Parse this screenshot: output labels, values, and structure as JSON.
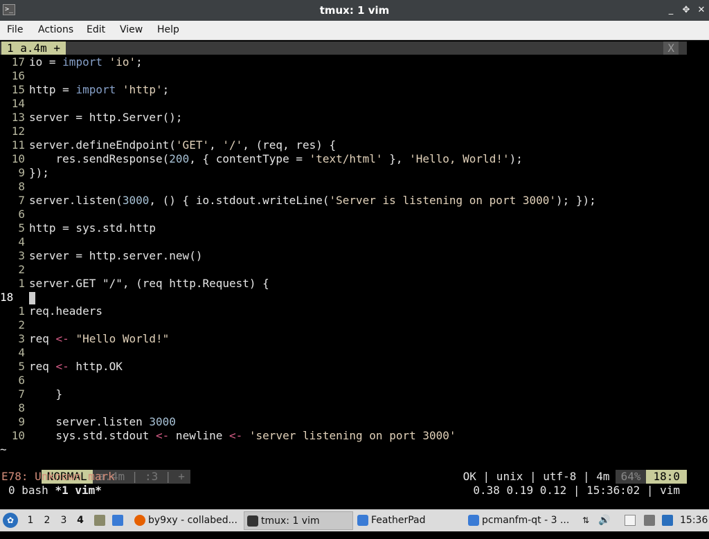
{
  "window": {
    "title": "tmux: 1 vim",
    "icon": "terminal-icon",
    "controls": [
      "_",
      "✥",
      "✕"
    ]
  },
  "menu": [
    "File",
    "Actions",
    "Edit",
    "View",
    "Help"
  ],
  "vim": {
    "tab_label": "1 a.4m +",
    "tab_close": "X",
    "lines": [
      {
        "n": "17",
        "segs": [
          [
            "t",
            "io = "
          ],
          [
            "kw",
            "import"
          ],
          [
            "t",
            " "
          ],
          [
            "str",
            "'io'"
          ],
          [
            "t",
            ";"
          ]
        ]
      },
      {
        "n": "16",
        "segs": []
      },
      {
        "n": "15",
        "segs": [
          [
            "t",
            "http = "
          ],
          [
            "kw",
            "import"
          ],
          [
            "t",
            " "
          ],
          [
            "str",
            "'http'"
          ],
          [
            "t",
            ";"
          ]
        ]
      },
      {
        "n": "14",
        "segs": []
      },
      {
        "n": "13",
        "segs": [
          [
            "t",
            "server = http.Server();"
          ]
        ]
      },
      {
        "n": "12",
        "segs": []
      },
      {
        "n": "11",
        "segs": [
          [
            "t",
            "server.defineEndpoint("
          ],
          [
            "str",
            "'GET'"
          ],
          [
            "t",
            ", "
          ],
          [
            "str",
            "'/'"
          ],
          [
            "t",
            ", (req, res) {"
          ]
        ]
      },
      {
        "n": "10",
        "segs": [
          [
            "t",
            "    res.sendResponse("
          ],
          [
            "num",
            "200"
          ],
          [
            "t",
            ", { contentType = "
          ],
          [
            "str",
            "'text/html'"
          ],
          [
            "t",
            " }, "
          ],
          [
            "str",
            "'Hello, World!'"
          ],
          [
            "t",
            ");"
          ]
        ]
      },
      {
        "n": "9",
        "segs": [
          [
            "t",
            "});"
          ]
        ]
      },
      {
        "n": "8",
        "segs": []
      },
      {
        "n": "7",
        "segs": [
          [
            "t",
            "server.listen("
          ],
          [
            "num",
            "3000"
          ],
          [
            "t",
            ", () { io.stdout.writeLine("
          ],
          [
            "str",
            "'Server is listening on port 3000'"
          ],
          [
            "t",
            "); });"
          ]
        ]
      },
      {
        "n": "6",
        "segs": []
      },
      {
        "n": "5",
        "segs": [
          [
            "t",
            "http = sys.std.http"
          ]
        ]
      },
      {
        "n": "4",
        "segs": []
      },
      {
        "n": "3",
        "segs": [
          [
            "t",
            "server = http.server.new()"
          ]
        ]
      },
      {
        "n": "2",
        "segs": []
      },
      {
        "n": "1",
        "segs": [
          [
            "t",
            "server.GET \"/\", (req http.Request) {"
          ]
        ]
      },
      {
        "n": "18",
        "current": true,
        "segs": []
      },
      {
        "n": "1",
        "segs": [
          [
            "t",
            "req.headers"
          ]
        ]
      },
      {
        "n": "2",
        "segs": []
      },
      {
        "n": "3",
        "segs": [
          [
            "t",
            "req "
          ],
          [
            "op",
            "<-"
          ],
          [
            "t",
            " "
          ],
          [
            "str",
            "\"Hello World!\""
          ]
        ]
      },
      {
        "n": "4",
        "segs": []
      },
      {
        "n": "5",
        "segs": [
          [
            "t",
            "req "
          ],
          [
            "op",
            "<-"
          ],
          [
            "t",
            " http.OK"
          ]
        ]
      },
      {
        "n": "6",
        "segs": []
      },
      {
        "n": "7",
        "segs": [
          [
            "t",
            "    }"
          ]
        ]
      },
      {
        "n": "8",
        "segs": []
      },
      {
        "n": "9",
        "segs": [
          [
            "t",
            "    server.listen "
          ],
          [
            "num",
            "3000"
          ]
        ]
      },
      {
        "n": "10",
        "segs": [
          [
            "t",
            "    sys.std.stdout "
          ],
          [
            "op",
            "<-"
          ],
          [
            "t",
            " newline "
          ],
          [
            "op",
            "<-"
          ],
          [
            "t",
            " "
          ],
          [
            "str",
            "'server listening on port 3000'"
          ]
        ]
      }
    ],
    "tilde": "~",
    "status": {
      "mode": "NORMAL",
      "file": "a.4m | :3 | +",
      "right_info": "OK | unix | utf-8 | 4m",
      "percent": "64%",
      "position": "18:0"
    },
    "message": "E78: Unknown mark"
  },
  "tmux": {
    "windows_prefix": "0 bash ",
    "active_window": "*1 vim*",
    "right": "0.38 0.19 0.12 | 15:36:02 | vim"
  },
  "taskbar": {
    "workspaces": [
      "1",
      "2",
      "3",
      "4"
    ],
    "active_workspace": "4",
    "tasks": [
      {
        "label": "by9xy - collabed...",
        "icon": "firefox-icon",
        "color": "#e66000"
      },
      {
        "label": "tmux: 1 vim",
        "icon": "terminal-icon",
        "color": "#333333",
        "active": true
      },
      {
        "label": "FeatherPad",
        "icon": "featherpad-icon",
        "color": "#3a7bd5"
      },
      {
        "label": "pcmanfm-qt - 3 ...",
        "icon": "folder-icon",
        "color": "#3a7bd5"
      }
    ],
    "clock": "15:36"
  }
}
